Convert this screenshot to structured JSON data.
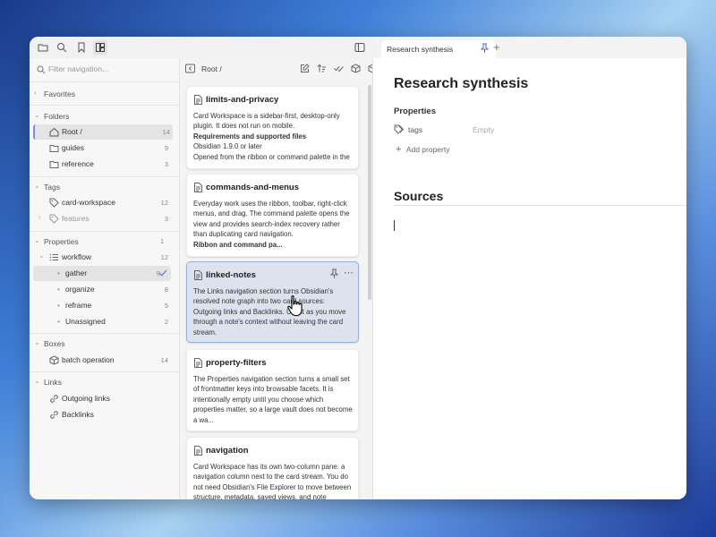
{
  "tab": {
    "title": "Research synthesis"
  },
  "nav": {
    "search_placeholder": "Filter navigation...",
    "favorites": "Favorites",
    "folders": "Folders",
    "folder_items": [
      {
        "label": "Root /",
        "count": "14"
      },
      {
        "label": "guides",
        "count": "9"
      },
      {
        "label": "reference",
        "count": "3"
      }
    ],
    "tags": "Tags",
    "tag_items": [
      {
        "label": "card-workspace",
        "count": "12"
      },
      {
        "label": "features",
        "count": "3"
      }
    ],
    "properties": "Properties",
    "properties_count": "1",
    "workflow": {
      "label": "workflow",
      "count": "12"
    },
    "workflow_items": [
      {
        "label": "gather",
        "count": "9"
      },
      {
        "label": "organize",
        "count": "8"
      },
      {
        "label": "reframe",
        "count": "5"
      },
      {
        "label": "Unassigned",
        "count": "2"
      }
    ],
    "boxes": "Boxes",
    "box_items": [
      {
        "label": "batch operation",
        "count": "14"
      }
    ],
    "links": "Links",
    "link_items": [
      {
        "label": "Outgoing links"
      },
      {
        "label": "Backlinks"
      }
    ]
  },
  "cards": {
    "breadcrumb": "Root /",
    "items": [
      {
        "title": "limits-and-privacy",
        "lines": [
          "Card Workspace is a sidebar-first, desktop-only plugin. It does not run on mobile."
        ],
        "bold": "Requirements and supported files",
        "after": [
          "Obsidian 1.9.0 or later",
          "Opened from the ribbon or command palette in the"
        ]
      },
      {
        "title": "commands-and-menus",
        "lines": [
          "Everyday work uses the ribbon, toolbar, right-click menus, and drag. The command palette opens the view and provides search-index recovery rather than duplicating card navigation."
        ],
        "bold": "Ribbon and command pa...",
        "after": []
      },
      {
        "title": "linked-notes",
        "lines": [
          "The Links navigation section turns Obsidian's resolved note graph into two card sources: Outgoing links and Backlinks. Use it as you move through a note's context without leaving the card stream."
        ],
        "bold": "",
        "after": []
      },
      {
        "title": "property-filters",
        "lines": [
          "The Properties navigation section turns a small set of frontmatter keys into browsable facets. It is intentionally empty until you choose which properties matter, so a large vault does not become a wa..."
        ],
        "bold": "",
        "after": []
      },
      {
        "title": "navigation",
        "lines": [
          "Card Workspace has its own two-column pane: a navigation column next to the card stream. You do not need Obsidian's File Explorer to move between structure, metadata, saved views, and note"
        ],
        "bold": "",
        "after": []
      }
    ]
  },
  "editor": {
    "title": "Research synthesis",
    "properties_label": "Properties",
    "prop_key": "tags",
    "prop_value": "Empty",
    "add_property": "Add property",
    "heading": "Sources"
  },
  "colors": {
    "accent": "#7b8fd8",
    "active_card": "#dde3ee"
  }
}
